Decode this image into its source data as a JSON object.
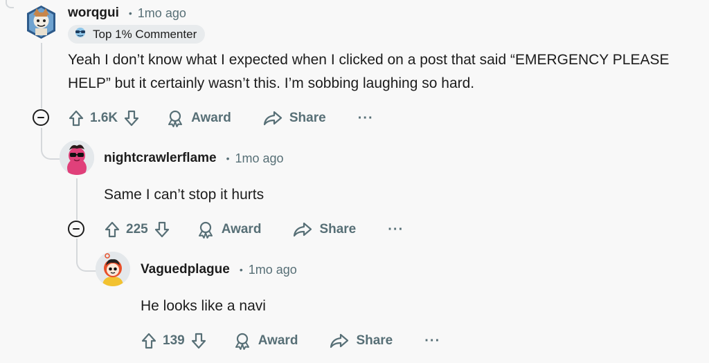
{
  "comments": [
    {
      "username": "worqgui",
      "separator": "•",
      "time": "1mo ago",
      "badge": {
        "icon": "sunglasses-icon",
        "label": "Top 1% Commenter"
      },
      "body": "Yeah I don’t know what I expected when I clicked on a post that said “EMERGENCY PLEASE HELP” but it certainly wasn’t this. I’m sobbing laughing so hard.",
      "votes": "1.6K",
      "award_label": "Award",
      "share_label": "Share",
      "more_label": "···"
    },
    {
      "username": "nightcrawlerflame",
      "separator": "•",
      "time": "1mo ago",
      "body": "Same I can’t stop it hurts",
      "votes": "225",
      "award_label": "Award",
      "share_label": "Share",
      "more_label": "···"
    },
    {
      "username": "Vaguedplague",
      "separator": "•",
      "time": "1mo ago",
      "body": "He looks like a navi",
      "votes": "139",
      "award_label": "Award",
      "share_label": "Share",
      "more_label": "···"
    }
  ],
  "colors": {
    "text": "#1c1c1c",
    "meta": "#576f76",
    "thread_line": "#d5d8db",
    "badge_bg": "#e8ebed",
    "background": "#f8f8f8"
  }
}
